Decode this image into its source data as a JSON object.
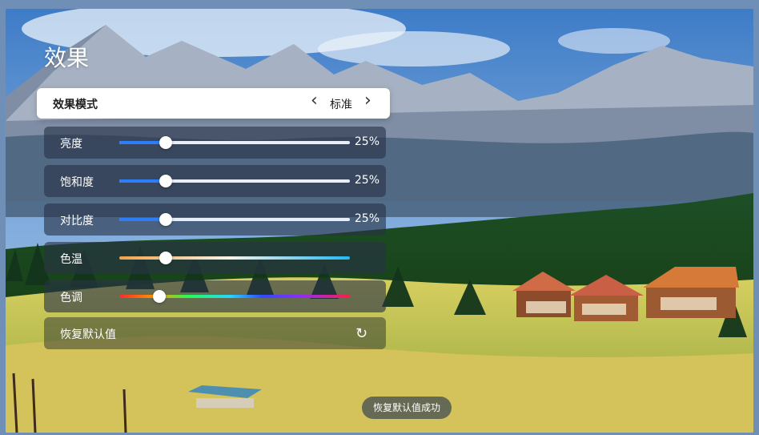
{
  "page": {
    "title": "效果",
    "mode_row": {
      "label": "效果模式",
      "prev_icon": "‹",
      "value": "标准",
      "next_icon": "›"
    },
    "sliders": [
      {
        "label": "亮度",
        "value_text": "25%",
        "fraction": 0.2
      },
      {
        "label": "饱和度",
        "value_text": "25%",
        "fraction": 0.2
      },
      {
        "label": "对比度",
        "value_text": "25%",
        "fraction": 0.2
      },
      {
        "label": "色温",
        "value_text": "",
        "fraction": 0.2
      },
      {
        "label": "色调",
        "value_text": "",
        "fraction": 0.18
      }
    ],
    "restore": {
      "label": "恢复默认值",
      "icon": "restore-icon"
    },
    "toast": "恢复默认值成功"
  }
}
